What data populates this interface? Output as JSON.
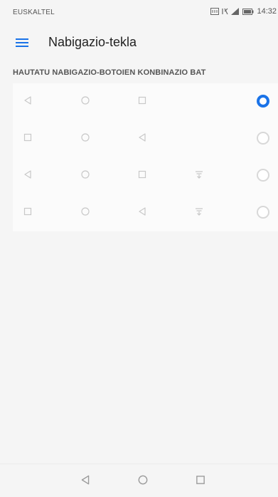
{
  "status_bar": {
    "carrier": "EUSKALTEL",
    "time": "14:32"
  },
  "app_bar": {
    "title": "Nabigazio-tekla"
  },
  "section": {
    "header": "HAUTATU NABIGAZIO-BOTOIEN KONBINAZIO BAT"
  },
  "options": [
    {
      "buttons": [
        "back",
        "home",
        "recents"
      ],
      "selected": true
    },
    {
      "buttons": [
        "recents",
        "home",
        "back"
      ],
      "selected": false
    },
    {
      "buttons": [
        "back",
        "home",
        "recents",
        "notifications"
      ],
      "selected": false
    },
    {
      "buttons": [
        "recents",
        "home",
        "back",
        "notifications"
      ],
      "selected": false
    }
  ],
  "system_nav": [
    "back",
    "home",
    "recents"
  ],
  "colors": {
    "accent": "#1a73e8",
    "icon_gray": "#c8c8c8"
  }
}
